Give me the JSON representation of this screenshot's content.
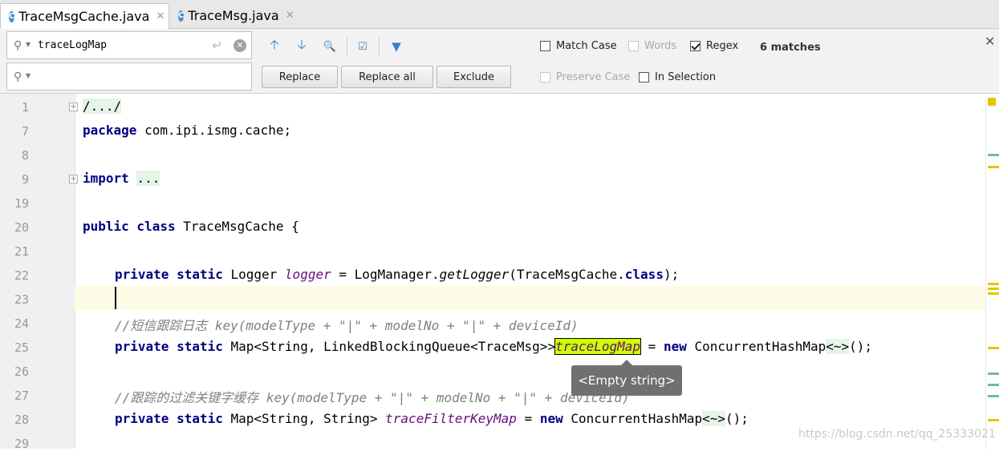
{
  "tabs": [
    {
      "label": "TraceMsgCache.java",
      "active": true
    },
    {
      "label": "TraceMsg.java",
      "active": false
    }
  ],
  "find": {
    "search_value": "traceLogMap",
    "replace_value": "",
    "replace_label": "Replace",
    "replace_all_label": "Replace all",
    "exclude_label": "Exclude",
    "options": {
      "match_case": {
        "label": "Match Case",
        "checked": false,
        "enabled": true
      },
      "words": {
        "label": "Words",
        "checked": false,
        "enabled": false
      },
      "regex": {
        "label": "Regex",
        "checked": true,
        "enabled": true
      },
      "preserve_case": {
        "label": "Preserve Case",
        "checked": false,
        "enabled": false
      },
      "in_selection": {
        "label": "In Selection",
        "checked": false,
        "enabled": true
      }
    },
    "match_count": "6 matches"
  },
  "editor": {
    "line_numbers": [
      "1",
      "7",
      "8",
      "9",
      "19",
      "20",
      "21",
      "22",
      "23",
      "24",
      "25",
      "26",
      "27",
      "28",
      "29"
    ],
    "lines": {
      "l1": "/.../",
      "l7_kw": "package",
      "l7_rest": " com.ipi.ismg.cache;",
      "l9_kw": "import",
      "l9_rest": "...",
      "l20_kw": "public class",
      "l20_rest": " TraceMsgCache {",
      "l22_kw": "private static",
      "l22_a": " Logger ",
      "l22_fld": "logger",
      "l22_b": " = LogManager.",
      "l22_mth": "getLogger",
      "l22_c": "(TraceMsgCache.",
      "l22_kw2": "class",
      "l22_d": ");",
      "l24_cmt": "//短信跟踪日志 key(modelType + \"|\" + modelNo + \"|\" + deviceId)",
      "l25_kw": "private static",
      "l25_a": " Map<String, LinkedBlockingQueue<TraceMsg>>",
      "l25_hit": "traceLogMap",
      "l25_b": " = ",
      "l25_kw2": "new",
      "l25_c": " ConcurrentHashMap",
      "l25_diamond": "<~>",
      "l25_d": "();",
      "l27_cmt": "//跟踪的过滤关键字缓存 key(modelType + \"|\" + modelNo + \"|\" + deviceId)",
      "l28_kw": "private static",
      "l28_a": " Map<String, String> ",
      "l28_fld": "traceFilterKeyMap",
      "l28_b": " = ",
      "l28_kw2": "new",
      "l28_c": " ConcurrentHashMap",
      "l28_diamond": "<~>",
      "l28_d": "();"
    },
    "tooltip": "<Empty string>"
  },
  "watermark": "https://blog.csdn.net/qq_25333021",
  "colors": {
    "keyword": "#000080",
    "field": "#660e7a",
    "comment": "#808080",
    "match_highlight": "#ccff00",
    "current_line": "#fdfae6"
  }
}
